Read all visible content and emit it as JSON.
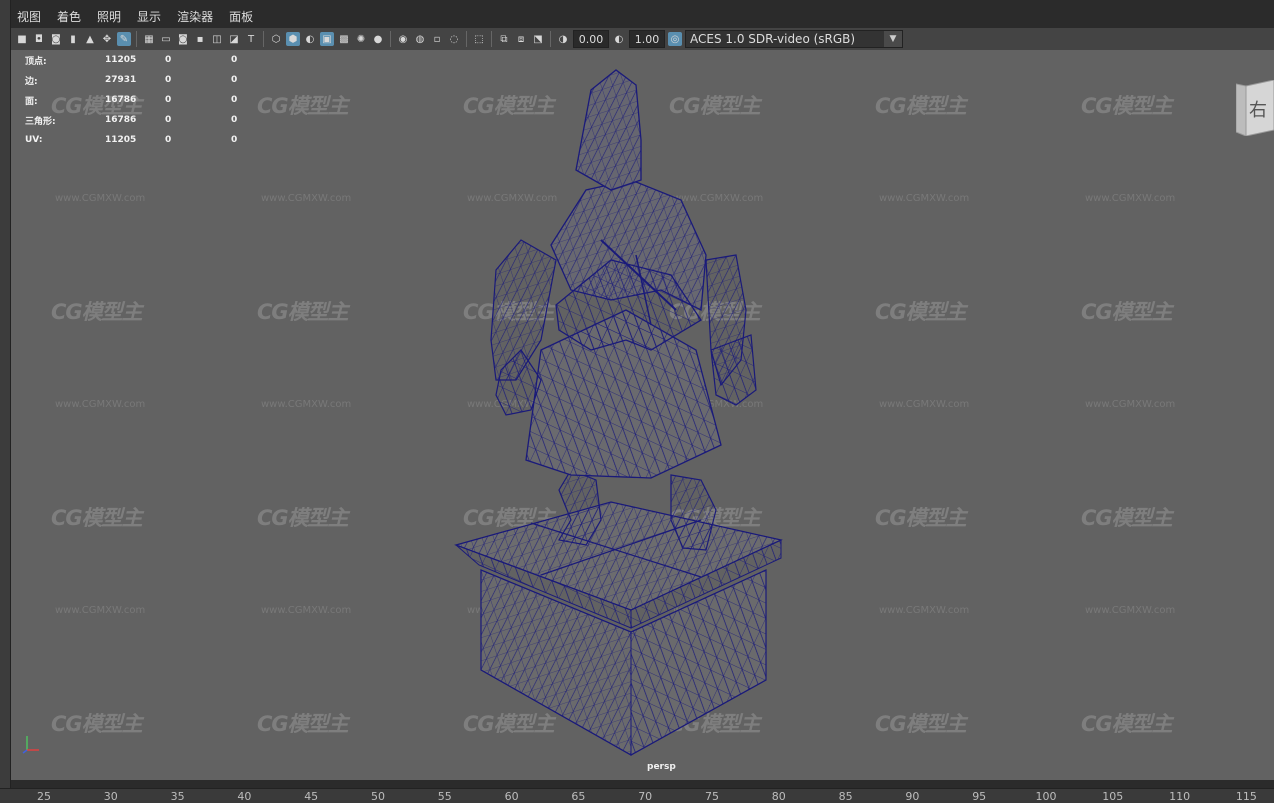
{
  "menu": [
    "视图",
    "着色",
    "照明",
    "显示",
    "渲染器",
    "面板"
  ],
  "toolbar": {
    "exposure_value": "0.00",
    "gamma_value": "1.00",
    "color_management": "ACES 1.0 SDR-video (sRGB)",
    "icons": [
      "camera-icon",
      "camera-attributes-icon",
      "bookmark-icon",
      "image-plane-icon",
      "grid-icon",
      "film-gate-icon",
      "resolution-gate-icon",
      "gate-mask-icon",
      "field-chart-icon",
      "safe-action-icon",
      "safe-title-icon",
      "wireframe-icon",
      "smooth-shade-icon",
      "default-material-icon",
      "textured-icon",
      "use-all-lights-icon",
      "shadows-icon",
      "ambient-occlusion-icon",
      "motion-blur-icon",
      "anti-aliasing-icon",
      "isolate-select-icon",
      "xray-icon",
      "xray-joints-icon",
      "backface-icon",
      "exposure-icon",
      "gamma-icon",
      "color-management-icon"
    ]
  },
  "hud": {
    "rows": [
      {
        "label": "顶点:",
        "v1": "11205",
        "v2": "0",
        "v3": "0"
      },
      {
        "label": "边:",
        "v1": "27931",
        "v2": "0",
        "v3": "0"
      },
      {
        "label": "面:",
        "v1": "16786",
        "v2": "0",
        "v3": "0"
      },
      {
        "label": "三角形:",
        "v1": "16786",
        "v2": "0",
        "v3": "0"
      },
      {
        "label": "UV:",
        "v1": "11205",
        "v2": "0",
        "v3": "0"
      }
    ]
  },
  "viewcube_face": "右",
  "camera": "persp",
  "watermark": {
    "logo": "CG模型主",
    "url": "www.CGMXW.com"
  },
  "ruler": {
    "ticks": [
      "25",
      "30",
      "35",
      "40",
      "45",
      "50",
      "55",
      "60",
      "65",
      "70",
      "75",
      "80",
      "85",
      "90",
      "95",
      "100",
      "105",
      "110",
      "115"
    ]
  },
  "colors": {
    "viewport_bg": "#626262",
    "wireframe": "#1a1a7a",
    "accent": "#5a8fb0"
  }
}
